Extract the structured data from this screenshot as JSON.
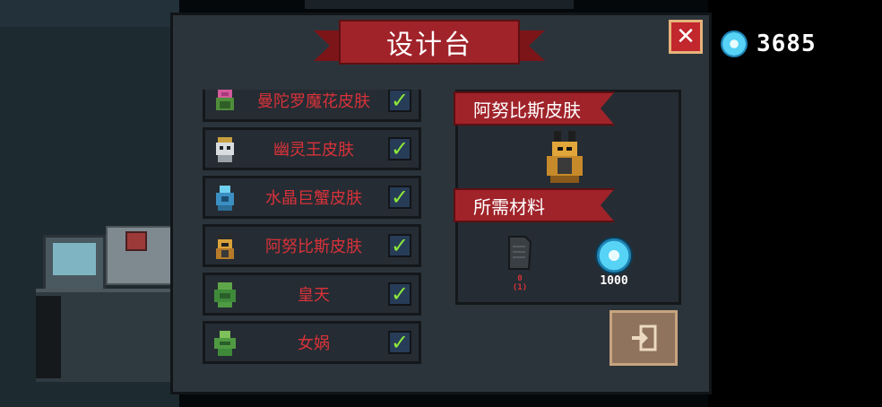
{
  "title": "设计台",
  "close_label": "✕",
  "currency": {
    "icon": "gem-icon",
    "value": "3685"
  },
  "skins": [
    {
      "name": "曼陀罗魔花皮肤",
      "icon": "mandala-flower-icon",
      "checked": true
    },
    {
      "name": "幽灵王皮肤",
      "icon": "ghost-king-icon",
      "checked": true
    },
    {
      "name": "水晶巨蟹皮肤",
      "icon": "crystal-crab-icon",
      "checked": true
    },
    {
      "name": "阿努比斯皮肤",
      "icon": "anubis-icon",
      "checked": true
    },
    {
      "name": "皇天",
      "icon": "huangtian-icon",
      "checked": true
    },
    {
      "name": "女娲",
      "icon": "nuwa-icon",
      "checked": true
    }
  ],
  "selected": {
    "name": "阿努比斯皮肤",
    "icon": "anubis-icon",
    "materials_heading": "所需材料",
    "materials": [
      {
        "icon": "document-icon",
        "count": "0",
        "required": "(1)"
      },
      {
        "icon": "gem-icon",
        "count": "1000"
      }
    ]
  },
  "colors": {
    "accent_red": "#a0232a",
    "text_red": "#d8323a",
    "check_green": "#8ce83c",
    "gem_blue": "#56d3f5"
  }
}
